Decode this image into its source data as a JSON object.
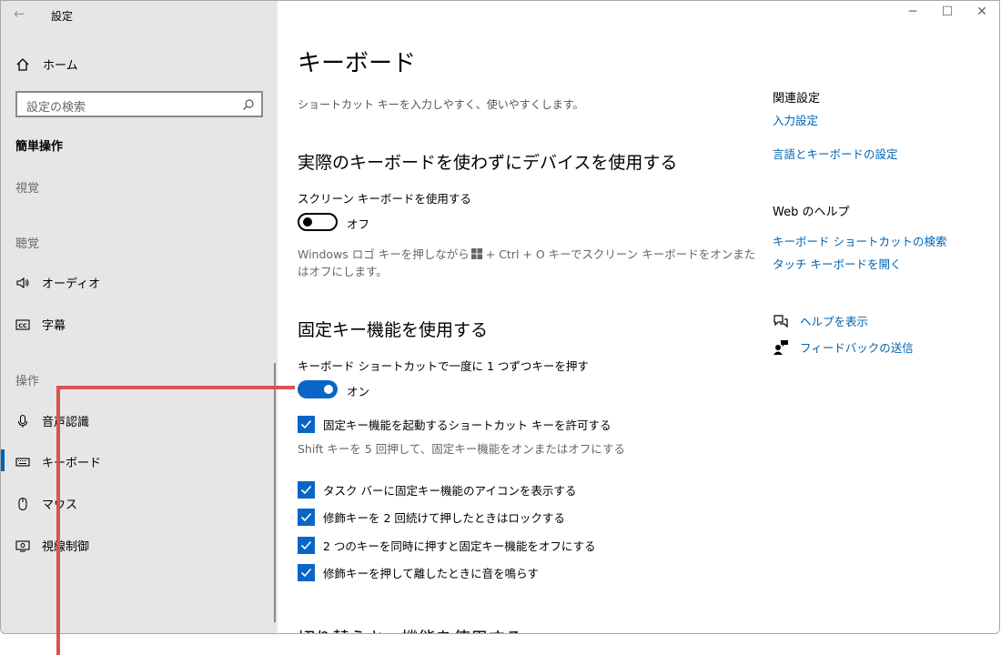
{
  "window": {
    "app_title": "設定",
    "controls": {
      "minimize": "─",
      "maximize": "☐",
      "close": "✕"
    }
  },
  "sidebar": {
    "home_label": "ホーム",
    "search_placeholder": "設定の検索",
    "section_title": "簡単操作",
    "groups": {
      "vision": "視覚",
      "hearing": "聴覚",
      "interaction": "操作"
    },
    "items": {
      "audio": "オーディオ",
      "captions": "字幕",
      "speech": "音声認識",
      "keyboard": "キーボード",
      "mouse": "マウス",
      "eye_control": "視線制御"
    },
    "selected": "keyboard"
  },
  "main": {
    "title": "キーボード",
    "subtitle": "ショートカット キーを入力しやすく、使いやすくします。",
    "onscreen": {
      "heading": "実際のキーボードを使わずにデバイスを使用する",
      "toggle_label": "スクリーン キーボードを使用する",
      "toggle_state": "オフ",
      "note_part1": "Windows ロゴ キーを押しながら",
      "note_part2": " + Ctrl + O キーでスクリーン キーボードをオンまた",
      "note_line2": "はオフにします。"
    },
    "sticky": {
      "heading": "固定キー機能を使用する",
      "toggle_label": "キーボード ショートカットで一度に 1 つずつキーを押す",
      "toggle_state": "オン",
      "check_shortcut": "固定キー機能を起動するショートカット キーを許可する",
      "shortcut_note": "Shift キーを 5 回押して、固定キー機能をオンまたはオフにする",
      "check_taskbar_icon": "タスク バーに固定キー機能のアイコンを表示する",
      "check_lock": "修飾キーを 2 回続けて押したときはロックする",
      "check_two_keys": "2 つのキーを同時に押すと固定キー機能をオフにする",
      "check_sound": "修飾キーを押して離したときに音を鳴らす"
    },
    "next_heading": "切り替えキー機能を使用する"
  },
  "aside": {
    "related_title": "関連設定",
    "link_input": "入力設定",
    "link_language": "言語とキーボードの設定",
    "web_help_title": "Web のヘルプ",
    "link_shortcuts": "キーボード ショートカットの検索",
    "link_touch": "タッチ キーボードを開く",
    "help_label": "ヘルプを表示",
    "feedback_label": "フィードバックの送信"
  },
  "colors": {
    "accent": "#0a66c6",
    "link": "#0063b1",
    "callout": "#d9534f",
    "sidebar_bg": "#e6e6e6"
  }
}
